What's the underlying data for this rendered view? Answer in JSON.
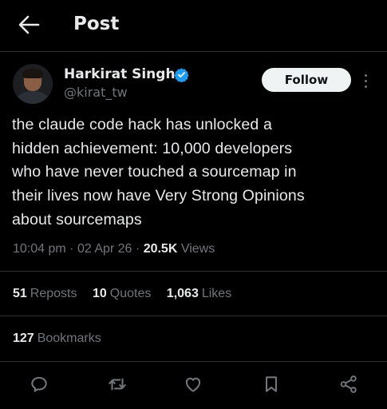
{
  "header": {
    "title": "Post",
    "back_icon": "arrow-left-icon"
  },
  "author": {
    "name": "Harkirat Singh",
    "handle": "@kirat_tw",
    "verified": true,
    "verified_color": "#1d9bf0"
  },
  "follow_label": "Follow",
  "tweet": {
    "text": "the claude code hack has unlocked a\nhidden achievement: 10,000 developers\nwho have never touched a sourcemap in\ntheir lives now have Very Strong Opinions\nabout sourcemaps",
    "time": "10:04 pm",
    "date": "02 Apr 26",
    "views_count": "20.5K",
    "views_label": "Views"
  },
  "stats": {
    "reposts": {
      "count": "51",
      "label": "Reposts"
    },
    "quotes": {
      "count": "10",
      "label": "Quotes"
    },
    "likes": {
      "count": "1,063",
      "label": "Likes"
    },
    "bookmarks": {
      "count": "127",
      "label": "Bookmarks"
    }
  },
  "actions": [
    "reply-icon",
    "repost-icon",
    "like-icon",
    "bookmark-icon",
    "share-icon"
  ]
}
